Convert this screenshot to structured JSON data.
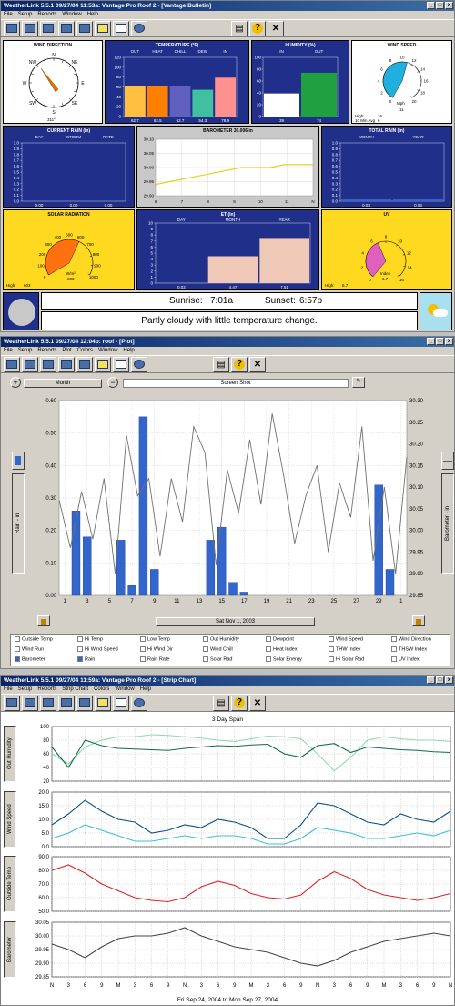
{
  "bulletin": {
    "title": "WeatherLink 5.5.1  09/27/04  11:53a: Vantage Pro Roof 2 - [Vantage Bulletin]",
    "menu": [
      "File",
      "Setup",
      "Reports",
      "Window",
      "Help"
    ],
    "wind_direction": {
      "title": "WIND DIRECTION",
      "compass": [
        "N",
        "NE",
        "E",
        "SE",
        "S",
        "SW",
        "W",
        "NW"
      ],
      "value": "311°"
    },
    "temperature": {
      "title": "TEMPERATURE (°F)",
      "cols": [
        "OUT",
        "HEAT",
        "CHILL",
        "DEW",
        "IN"
      ],
      "values": [
        62.7,
        62.5,
        62.7,
        54.3,
        78.9
      ],
      "value_labels": [
        "62.7",
        "62.5",
        "62.7",
        "54.3",
        "78.9"
      ],
      "scale": [
        "120",
        "100",
        "80",
        "60",
        "40",
        "20",
        "0"
      ],
      "colors": [
        "#ffc040",
        "#ff8000",
        "#6060c0",
        "#40c0a0",
        "#ff9090"
      ]
    },
    "humidity": {
      "title": "HUMIDITY (%)",
      "cols": [
        "IN",
        "OUT"
      ],
      "values": [
        39,
        74
      ],
      "value_labels": [
        "39",
        "74"
      ],
      "scale": [
        "100",
        "80",
        "60",
        "40",
        "20",
        "0"
      ]
    },
    "wind_speed": {
      "title": "WIND SPEED",
      "ticks": [
        "0",
        "2",
        "4",
        "6",
        "8",
        "10",
        "12",
        "14",
        "16",
        "18",
        "20"
      ],
      "unit": "Mph",
      "value": "11",
      "high_label": "High:",
      "high_value": "16",
      "avg_label": "10 Min Avg",
      "avg_value": "6"
    },
    "current_rain": {
      "title": "CURRENT RAIN (in)",
      "cols": [
        "DAY",
        "STORM",
        "RATE"
      ],
      "scale": [
        "1.0",
        "0.9",
        "0.8",
        "0.7",
        "0.6",
        "0.5",
        "0.4",
        "0.3",
        "0.2",
        "0.1",
        "0.0"
      ],
      "values": [
        "0.00",
        "0.00",
        "0.00"
      ]
    },
    "barometer": {
      "title": "BAROMETER 30.006 in",
      "scale": [
        "30.10",
        "30.05",
        "30.00",
        "29.95",
        "29.90"
      ],
      "xticks": [
        "6",
        "7",
        "8",
        "9",
        "10",
        "11",
        "N"
      ],
      "values": [
        29.94,
        29.95,
        29.96,
        29.97,
        29.98,
        29.99,
        30.0,
        30.0,
        30.0,
        30.01,
        30.01,
        30.01
      ]
    },
    "total_rain": {
      "title": "TOTAL RAIN (in)",
      "cols": [
        "MONTH",
        "YEAR"
      ],
      "scale": [
        "1.0",
        "0.9",
        "0.8",
        "0.7",
        "0.6",
        "0.5",
        "0.4",
        "0.3",
        "0.2",
        "0.1",
        "0.0"
      ],
      "values": [
        0.03,
        0.03
      ],
      "value_labels": [
        "0.03",
        "0.03"
      ]
    },
    "solar": {
      "title": "SOLAR RADIATION",
      "ticks": [
        "0",
        "100",
        "200",
        "300",
        "400",
        "500",
        "600",
        "700",
        "800",
        "900",
        "1000"
      ],
      "unit": "W/m²",
      "value": "603",
      "high_label": "High:",
      "high_value": "603"
    },
    "et": {
      "title": "ET (in)",
      "cols": [
        "DAY",
        "MONTH",
        "YEAR"
      ],
      "values": [
        0.02,
        4.47,
        7.51
      ],
      "value_labels": [
        "0.02",
        "4.47",
        "7.51"
      ],
      "scale": [
        "10",
        "9",
        "8",
        "7",
        "6",
        "5",
        "4",
        "3",
        "2",
        "1",
        "0"
      ]
    },
    "uv": {
      "title": "UV",
      "ticks": [
        "0",
        "2",
        "4",
        "6",
        "8",
        "10",
        "12",
        "14",
        "16"
      ],
      "unit": "Index",
      "value": "6.7",
      "high_label": "High:",
      "high_value": "6.7"
    },
    "sunrise_label": "Sunrise:",
    "sunrise": "7:01a",
    "sunset_label": "Sunset:",
    "sunset": "6:57p",
    "forecast": "Partly cloudy with little temperature change."
  },
  "plot": {
    "title": "WeatherLink 5.5.1  09/27/04  12:04p: roof - [Plot]",
    "menu": [
      "File",
      "Setup",
      "Reports",
      "Plot",
      "Colors",
      "Window",
      "Help"
    ],
    "period": "Month",
    "screen_shot": "Screen Shot",
    "date_label": "Sat Nov 1, 2003",
    "left_axis_label": "Rain - in",
    "right_axis_label": "Barometer - in",
    "left_scale": [
      "0.60",
      "0.50",
      "0.40",
      "0.30",
      "0.20",
      "0.10",
      "0.00"
    ],
    "right_scale": [
      "30.30",
      "30.25",
      "30.20",
      "30.15",
      "30.10",
      "30.05",
      "30.00",
      "29.95",
      "29.90",
      "29.85"
    ],
    "xticks": [
      "1",
      "3",
      "5",
      "7",
      "9",
      "11",
      "13",
      "15",
      "17",
      "19",
      "21",
      "23",
      "25",
      "27",
      "29",
      "1"
    ],
    "rain_days": [
      2,
      3,
      6,
      7,
      8,
      9,
      14,
      15,
      16,
      17,
      29,
      30
    ],
    "rain_values": [
      0.26,
      0.18,
      0.17,
      0.03,
      0.55,
      0.08,
      0.17,
      0.21,
      0.04,
      0.01,
      0.34,
      0.08
    ],
    "baro_values": [
      30.07,
      29.96,
      30.09,
      29.98,
      30.12,
      29.9,
      30.22,
      30.08,
      30.12,
      29.94,
      30.12,
      30.02,
      30.24,
      30.18,
      29.92,
      30.14,
      30.04,
      30.21,
      30.06,
      30.27,
      30.13,
      29.97,
      30.08,
      30.15,
      29.95,
      30.11,
      30.03,
      30.24,
      29.93,
      30.1,
      29.9,
      30.17
    ],
    "checkboxes": [
      {
        "label": "Outside Temp",
        "on": false
      },
      {
        "label": "Hi Temp",
        "on": false
      },
      {
        "label": "Low Temp",
        "on": false
      },
      {
        "label": "Out Humidity",
        "on": false
      },
      {
        "label": "Dewpoint",
        "on": false
      },
      {
        "label": "Wind Speed",
        "on": false
      },
      {
        "label": "Wind Direction",
        "on": false
      },
      {
        "label": "Wind Run",
        "on": false
      },
      {
        "label": "Hi Wind Speed",
        "on": false
      },
      {
        "label": "Hi Wind Dir",
        "on": false
      },
      {
        "label": "Wind Chill",
        "on": false
      },
      {
        "label": "Heat Index",
        "on": false
      },
      {
        "label": "THW Index",
        "on": false
      },
      {
        "label": "THSW Index",
        "on": false
      },
      {
        "label": "Barometer",
        "on": true
      },
      {
        "label": "Rain",
        "on": true
      },
      {
        "label": "Rain Rate",
        "on": false
      },
      {
        "label": "Solar Rad",
        "on": false
      },
      {
        "label": "Solar Energy",
        "on": false
      },
      {
        "label": "Hi Solar Rad",
        "on": false
      },
      {
        "label": "UV Index",
        "on": false
      }
    ]
  },
  "strip": {
    "title": "WeatherLink 5.5.1  09/27/04  11:59a: Vantage Pro Roof 2 - [Strip Chart]",
    "menu": [
      "File",
      "Setup",
      "Reports",
      "Strip Chart",
      "Colors",
      "Window",
      "Help"
    ],
    "span": "3 Day Span",
    "date_range": "Fri Sep 24, 2004  to  Mon Sep 27, 2004",
    "xticks": [
      "N",
      "3",
      "6",
      "9",
      "M",
      "3",
      "6",
      "9",
      "N",
      "3",
      "6",
      "9",
      "M",
      "3",
      "6",
      "9",
      "N",
      "3",
      "6",
      "9",
      "M",
      "3",
      "6",
      "9",
      "N"
    ],
    "charts": [
      {
        "label": "Out Humidity",
        "scale": [
          "100",
          "80",
          "60",
          "40",
          "20"
        ],
        "min": 20,
        "max": 100,
        "series": [
          {
            "color": "#8fd9b0",
            "values": [
              60,
              45,
              70,
              80,
              85,
              85,
              88,
              87,
              85,
              83,
              80,
              78,
              82,
              86,
              85,
              82,
              60,
              35,
              55,
              80,
              85,
              82,
              80,
              80,
              78
            ]
          },
          {
            "color": "#0e6b4a",
            "values": [
              70,
              40,
              80,
              72,
              68,
              67,
              66,
              65,
              68,
              70,
              72,
              71,
              73,
              74,
              60,
              55,
              72,
              75,
              62,
              70,
              68,
              66,
              65,
              63,
              62
            ]
          }
        ]
      },
      {
        "label": "Wind Speed",
        "scale": [
          "20.0",
          "15.0",
          "10.0",
          "5.0",
          "0.0"
        ],
        "min": 0,
        "max": 20,
        "series": [
          {
            "color": "#0a4f8a",
            "values": [
              8,
              12,
              17,
              13,
              10,
              9,
              5,
              6,
              8,
              7,
              10,
              9,
              7,
              3,
              3,
              8,
              16,
              15,
              12,
              9,
              8,
              12,
              10,
              9,
              13
            ]
          },
          {
            "color": "#38c0d8",
            "values": [
              3,
              5,
              8,
              6,
              4,
              2,
              2,
              3,
              4,
              3,
              4,
              4,
              3,
              1,
              1,
              3,
              7,
              6,
              5,
              3,
              3,
              4,
              5,
              4,
              6
            ]
          }
        ]
      },
      {
        "label": "Outside Temp",
        "scale": [
          "90.0",
          "80.0",
          "70.0",
          "60.0",
          "50.0"
        ],
        "min": 50,
        "max": 90,
        "series": [
          {
            "color": "#e02020",
            "values": [
              80,
              84,
              78,
              70,
              65,
              60,
              58,
              57,
              60,
              68,
              72,
              69,
              63,
              60,
              59,
              62,
              72,
              79,
              74,
              66,
              62,
              60,
              58,
              60,
              63
            ]
          }
        ]
      },
      {
        "label": "Barometer",
        "scale": [
          "30.05",
          "30.00",
          "29.95",
          "29.90",
          "29.85"
        ],
        "min": 29.85,
        "max": 30.05,
        "series": [
          {
            "color": "#444444",
            "values": [
              29.97,
              29.95,
              29.92,
              29.96,
              29.99,
              30.0,
              30.0,
              30.01,
              30.03,
              30.0,
              29.98,
              29.96,
              29.95,
              29.94,
              29.92,
              29.9,
              29.89,
              29.91,
              29.94,
              29.96,
              29.98,
              29.99,
              30.0,
              30.01,
              30.0
            ]
          }
        ]
      }
    ]
  }
}
